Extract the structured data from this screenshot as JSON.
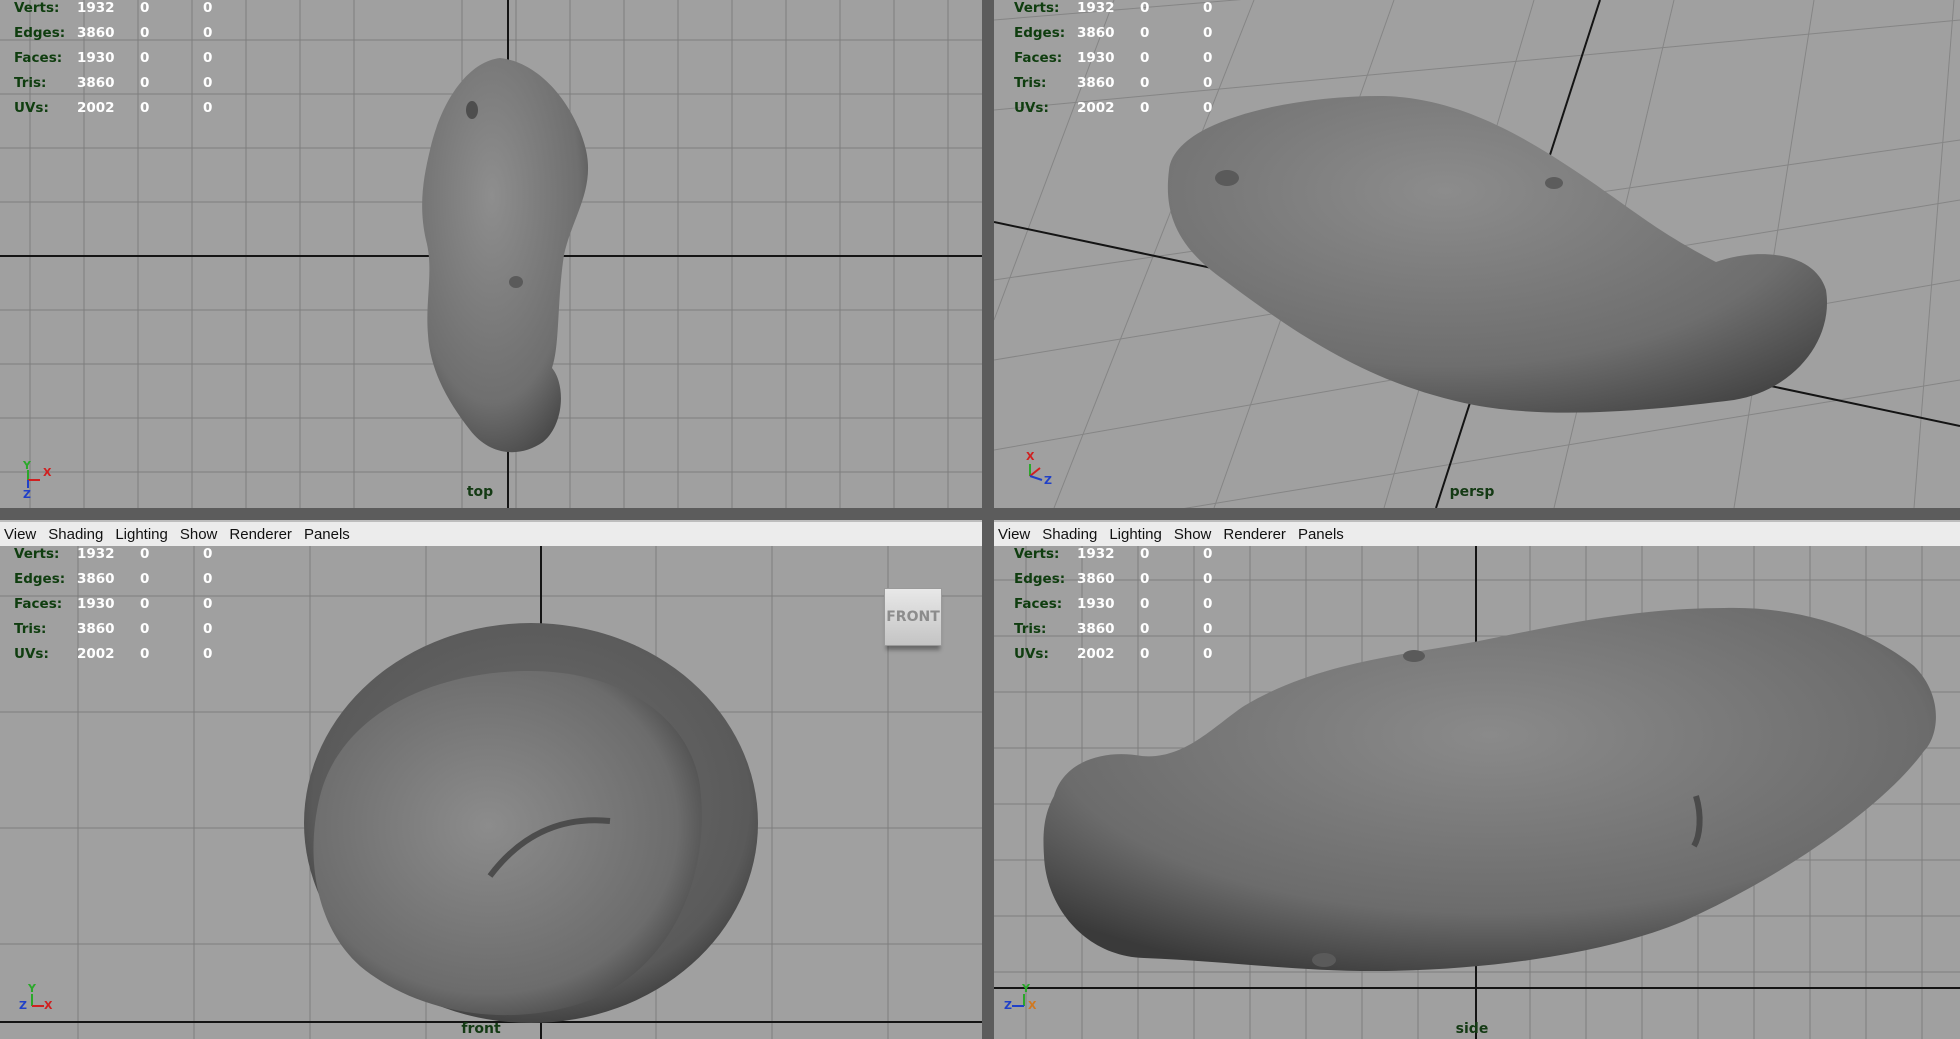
{
  "colors": {
    "viewport_bg": "#a0a0a0",
    "grid_line": "#7e7e7e",
    "axis_line": "#141414",
    "menubar_bg": "#ececec",
    "hud_label": "#0f3d0f",
    "hud_value": "#ffffff",
    "camera_label": "#143a14"
  },
  "menu": [
    "View",
    "Shading",
    "Lighting",
    "Show",
    "Renderer",
    "Panels"
  ],
  "stats": [
    {
      "label": "Verts:",
      "v": "1932",
      "a": "0",
      "b": "0"
    },
    {
      "label": "Edges:",
      "v": "3860",
      "a": "0",
      "b": "0"
    },
    {
      "label": "Faces:",
      "v": "1930",
      "a": "0",
      "b": "0"
    },
    {
      "label": "Tris:",
      "v": "3860",
      "a": "0",
      "b": "0"
    },
    {
      "label": "UVs:",
      "v": "2002",
      "a": "0",
      "b": "0"
    }
  ],
  "viewports": {
    "top": {
      "camera": "top",
      "axis": {
        "up": "Y",
        "right": "X",
        "down": "Z"
      }
    },
    "persp": {
      "camera": "persp",
      "axis": {
        "up": "X",
        "right": "Z"
      }
    },
    "front": {
      "camera": "front",
      "axis": {
        "up": "Y",
        "right": "X",
        "left": "Z"
      },
      "view_cube": "FRONT"
    },
    "side": {
      "camera": "side",
      "axis": {
        "up": "Y",
        "right": "X",
        "left": "Z"
      }
    }
  }
}
